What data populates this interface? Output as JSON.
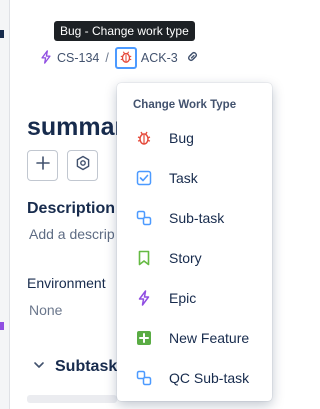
{
  "tooltip": "Bug - Change work type",
  "breadcrumbs": {
    "parent_key": "CS-134",
    "separator": "/",
    "current_key_suffix": "ACK-3"
  },
  "issue": {
    "title": "summar"
  },
  "sections": {
    "description_heading": "Description",
    "description_placeholder": "Add a descrip",
    "environment_label": "Environment",
    "environment_value": "None",
    "subtasks_heading": "Subtask"
  },
  "menu": {
    "heading": "Change Work Type",
    "items": [
      {
        "label": "Bug",
        "icon": "bug-icon",
        "color": "#e5493a"
      },
      {
        "label": "Task",
        "icon": "task-icon",
        "color": "#4c9aff"
      },
      {
        "label": "Sub-task",
        "icon": "subtask-icon",
        "color": "#4c9aff"
      },
      {
        "label": "Story",
        "icon": "story-icon",
        "color": "#65ba43"
      },
      {
        "label": "Epic",
        "icon": "epic-icon",
        "color": "#904ee2"
      },
      {
        "label": "New Feature",
        "icon": "new-feature-icon",
        "color": "#5aac44"
      },
      {
        "label": "QC Sub-task",
        "icon": "qc-subtask-icon",
        "color": "#4c9aff"
      }
    ]
  },
  "colors": {
    "tooltip_bg": "#1d2125",
    "accent_blue": "#4c9aff",
    "epic_purple": "#904ee2",
    "bug_red": "#e5493a"
  }
}
